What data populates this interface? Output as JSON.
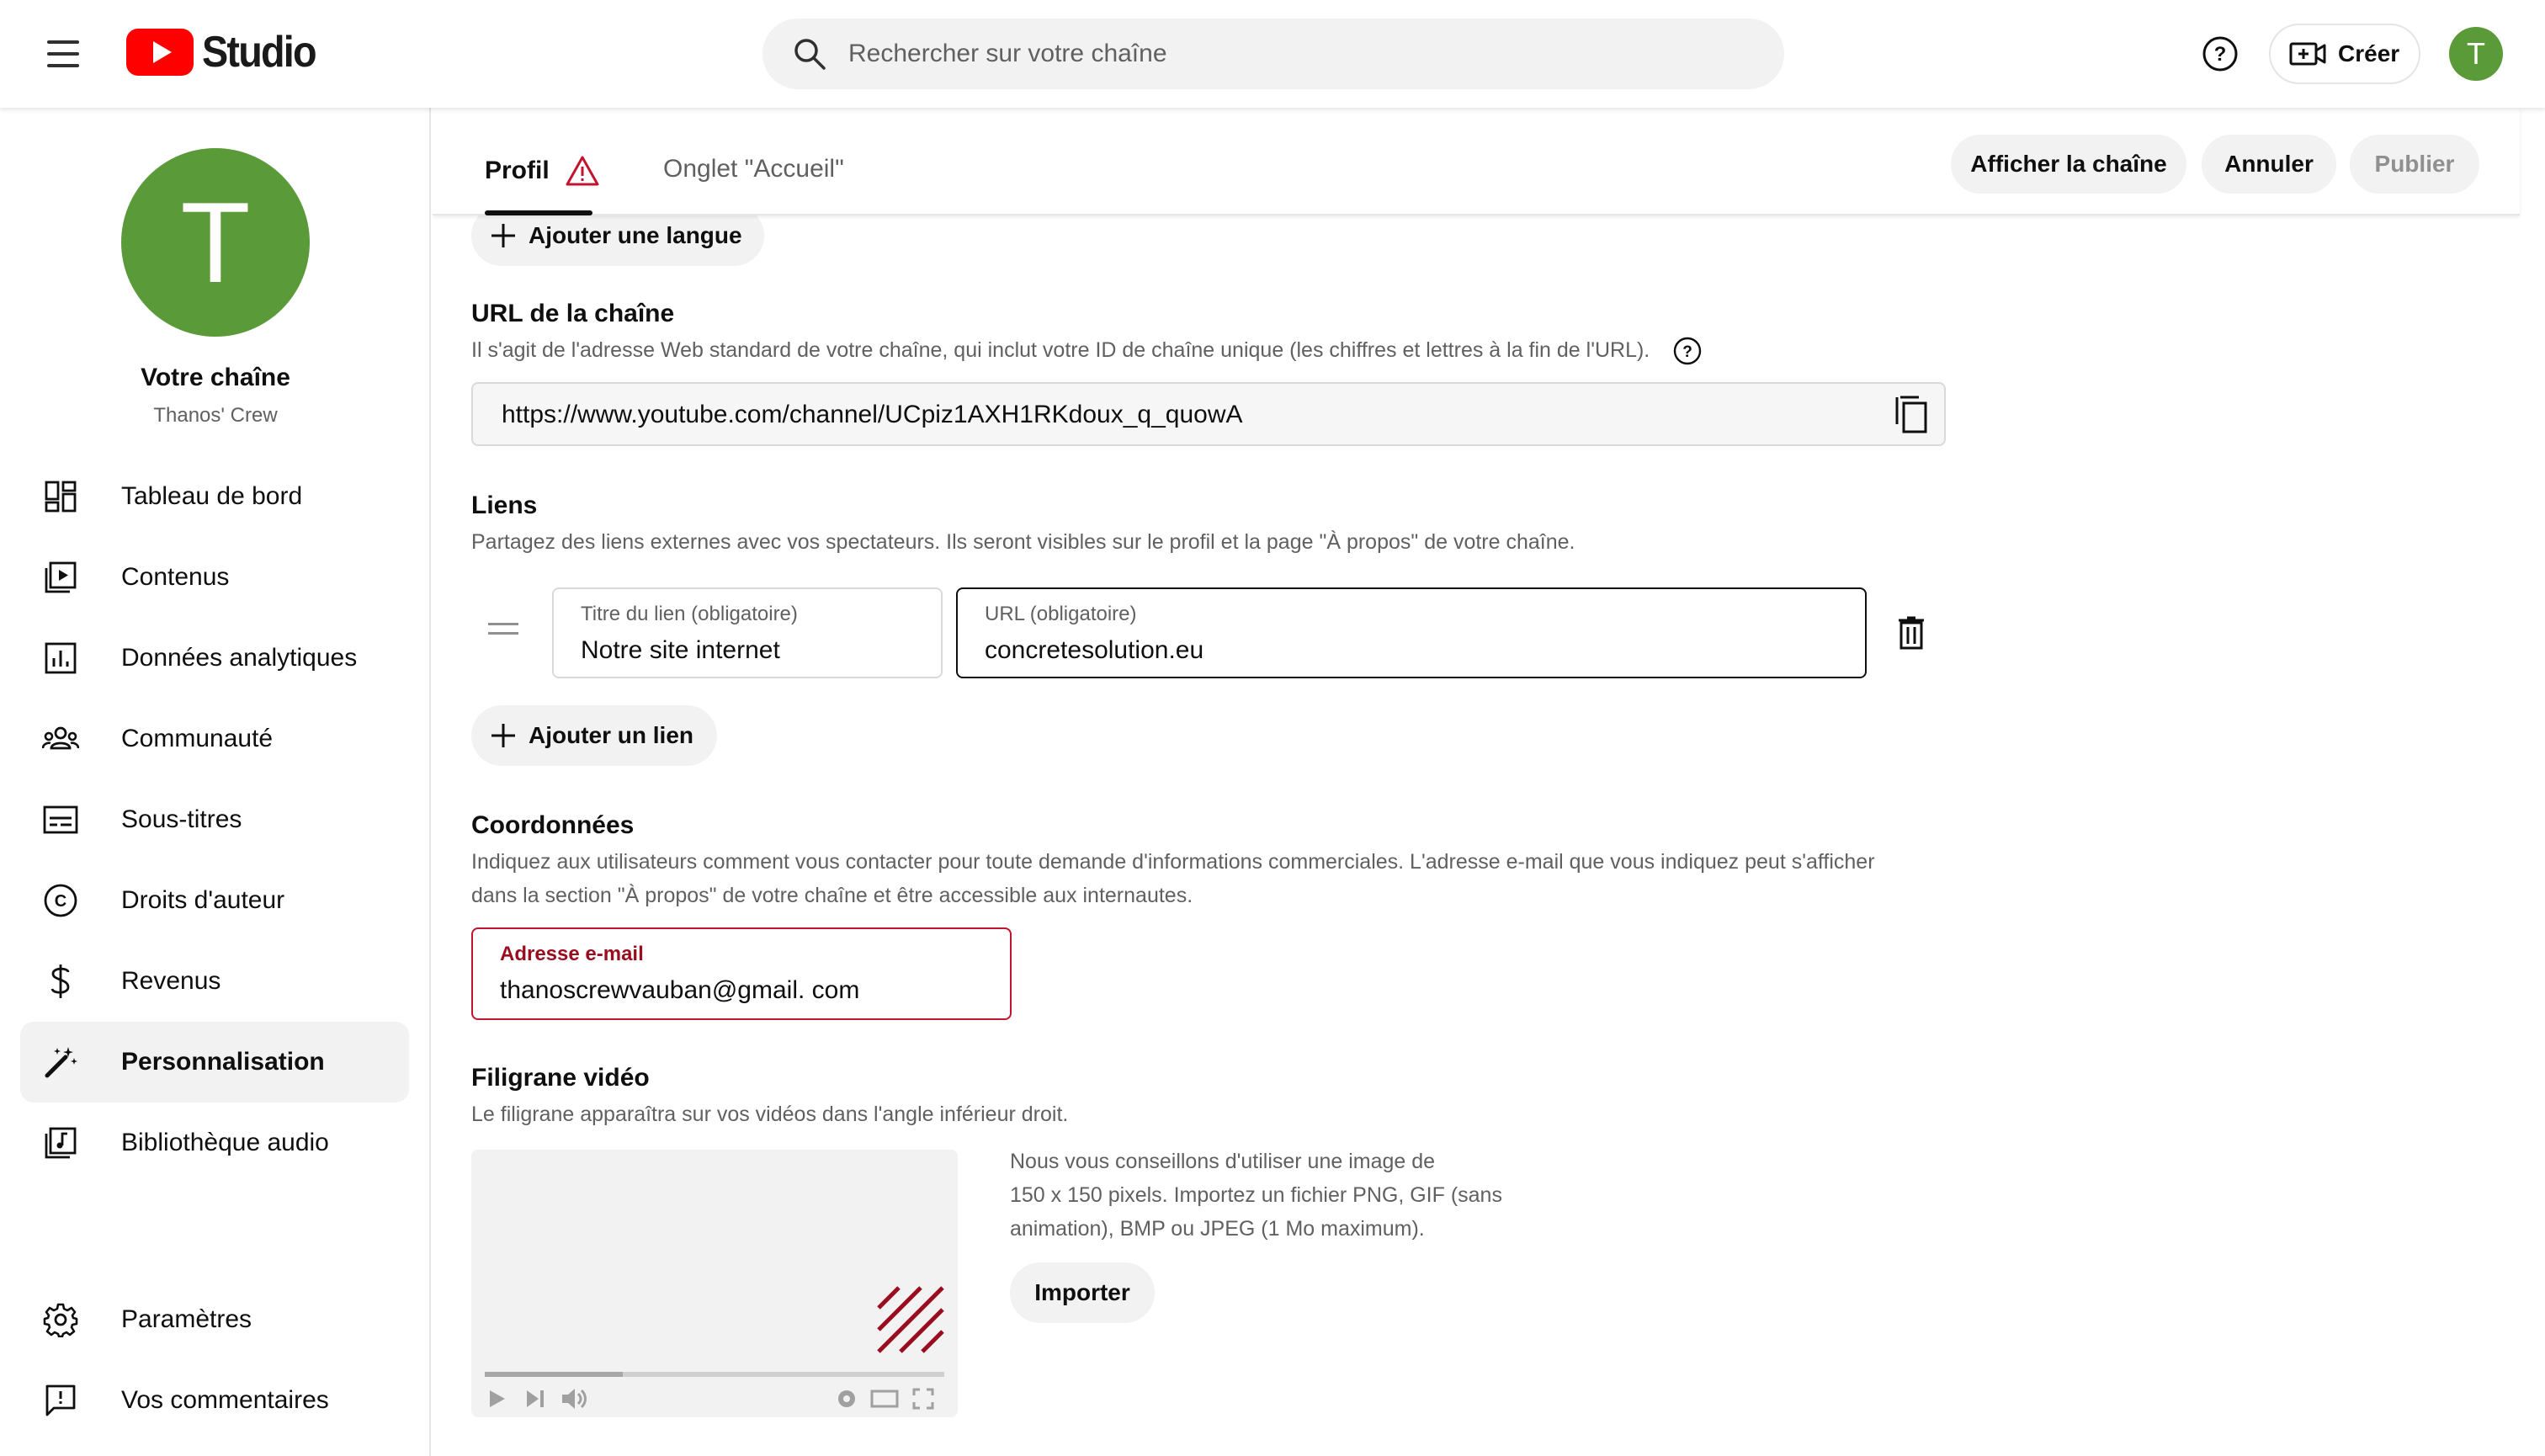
{
  "header": {
    "studio_label": "Studio",
    "search_placeholder": "Rechercher sur votre chaîne",
    "create_label": "Créer",
    "avatar_letter": "T",
    "brand_color": "#ff0000",
    "avatar_color": "#5b9a38"
  },
  "sidebar": {
    "avatar_letter": "T",
    "channel_title": "Votre chaîne",
    "channel_subtitle": "Thanos' Crew",
    "items": [
      {
        "label": "Tableau de bord",
        "icon": "dashboard-icon"
      },
      {
        "label": "Contenus",
        "icon": "content-icon"
      },
      {
        "label": "Données analytiques",
        "icon": "analytics-icon"
      },
      {
        "label": "Communauté",
        "icon": "community-icon"
      },
      {
        "label": "Sous-titres",
        "icon": "subtitles-icon"
      },
      {
        "label": "Droits d'auteur",
        "icon": "copyright-icon"
      },
      {
        "label": "Revenus",
        "icon": "dollar-icon"
      },
      {
        "label": "Personnalisation",
        "icon": "magic-wand-icon",
        "active": true
      },
      {
        "label": "Bibliothèque audio",
        "icon": "audio-library-icon"
      }
    ],
    "bottom_items": [
      {
        "label": "Paramètres",
        "icon": "gear-icon"
      },
      {
        "label": "Vos commentaires",
        "icon": "feedback-icon"
      }
    ]
  },
  "tabs": {
    "profil": "Profil",
    "accueil": "Onglet \"Accueil\"",
    "view_channel": "Afficher la chaîne",
    "cancel": "Annuler",
    "publish": "Publier"
  },
  "main": {
    "add_language": "Ajouter une langue",
    "url_section": {
      "title": "URL de la chaîne",
      "description": "Il s'agit de l'adresse Web standard de votre chaîne, qui inclut votre ID de chaîne unique (les chiffres et lettres à la fin de l'URL).",
      "value": "https://www.youtube.com/channel/UCpiz1AXH1RKdoux_q_quowA"
    },
    "links_section": {
      "title": "Liens",
      "description": "Partagez des liens externes avec vos spectateurs. Ils seront visibles sur le profil et la page \"À propos\" de votre chaîne.",
      "link_title_label": "Titre du lien (obligatoire)",
      "link_title_value": "Notre site internet",
      "link_url_label": "URL (obligatoire)",
      "link_url_value": "concretesolution.eu",
      "add_link": "Ajouter un lien"
    },
    "contact_section": {
      "title": "Coordonnées",
      "description_line1": "Indiquez aux utilisateurs comment vous contacter pour toute demande d'informations commerciales. L'adresse e-mail que vous indiquez peut s'afficher",
      "description_line2": "dans la section \"À propos\" de votre chaîne et être accessible aux internautes.",
      "email_label": "Adresse e-mail",
      "email_value": "thanoscrewvauban@gmail. com",
      "error_color": "#9a0d1e"
    },
    "watermark_section": {
      "title": "Filigrane vidéo",
      "description": "Le filigrane apparaîtra sur vos vidéos dans l'angle inférieur droit.",
      "hint_line1": "Nous vous conseillons d'utiliser une image de",
      "hint_line2": "150 x 150 pixels. Importez un fichier PNG, GIF (sans",
      "hint_line3": "animation), BMP ou JPEG (1 Mo maximum).",
      "import": "Importer"
    }
  }
}
